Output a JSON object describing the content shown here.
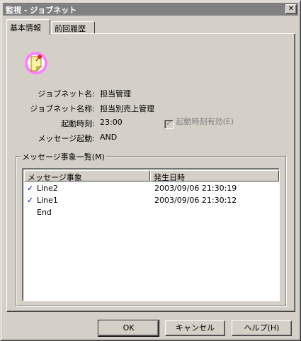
{
  "window": {
    "title": "監視 - ジョブネット",
    "close_glyph": "✕"
  },
  "tabs": [
    {
      "label": "基本情報"
    },
    {
      "label": "前回履歴"
    }
  ],
  "icon": {
    "name": "jobnet-memo-icon"
  },
  "fields": {
    "jobnet_name_label": "ジョブネット名:",
    "jobnet_name_value": "担当管理",
    "jobnet_title_label": "ジョブネット名称:",
    "jobnet_title_value": "担当別売上管理",
    "start_time_label": "起動時刻:",
    "start_time_value": "23:00",
    "start_time_enabled_label": "起動時刻有効(E)",
    "start_time_enabled_checked": true,
    "message_trigger_label": "メッセージ起動:",
    "message_trigger_value": "AND"
  },
  "message_list": {
    "group_label": "メッセージ事象一覧(M)",
    "columns": [
      "メッセージ事象",
      "発生日時"
    ],
    "rows": [
      {
        "checked": "✓",
        "name": "Line2",
        "datetime": "2003/09/06 21:30:19"
      },
      {
        "checked": "✓",
        "name": "Line1",
        "datetime": "2003/09/06 21:30:12"
      },
      {
        "checked": "",
        "name": "End",
        "datetime": ""
      }
    ]
  },
  "buttons": {
    "ok": "OK",
    "cancel": "キャンセル",
    "help": "ヘルプ(H)"
  },
  "colors": {
    "titlebar": "#808080",
    "dialog": "#d4d0c8",
    "icon_ring": "#ff80ff",
    "pin": "#e02020"
  }
}
